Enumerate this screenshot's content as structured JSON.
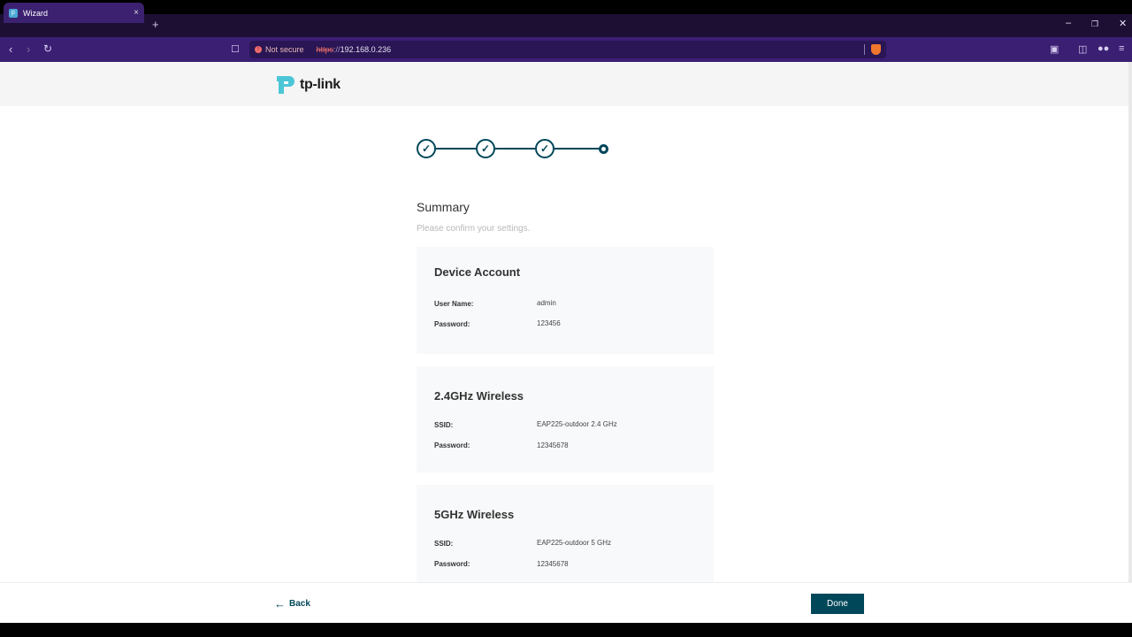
{
  "browser": {
    "tab_title": "Wizard",
    "tab_close": "×",
    "new_tab": "+",
    "not_secure": "Not secure",
    "url_scheme": "https",
    "url_sep": "://",
    "url_host": "192.168.0.236"
  },
  "logo": {
    "text": "tp-link"
  },
  "summary": {
    "title": "Summary",
    "subtitle": "Please confirm your settings."
  },
  "cards": [
    {
      "title": "Device Account",
      "rows": [
        {
          "label": "User Name:",
          "value": "admin"
        },
        {
          "label": "Password:",
          "value": "123456"
        }
      ]
    },
    {
      "title": "2.4GHz Wireless",
      "rows": [
        {
          "label": "SSID:",
          "value": "EAP225-outdoor 2.4 GHz"
        },
        {
          "label": "Password:",
          "value": "12345678"
        }
      ]
    },
    {
      "title": "5GHz Wireless",
      "rows": [
        {
          "label": "SSID:",
          "value": "EAP225-outdoor 5 GHz"
        },
        {
          "label": "Password:",
          "value": "12345678"
        }
      ]
    }
  ],
  "footer": {
    "back_label": "Back",
    "done_label": "Done"
  },
  "colors": {
    "accent": "#00475a",
    "browser_toolbar": "#3b1f73"
  }
}
